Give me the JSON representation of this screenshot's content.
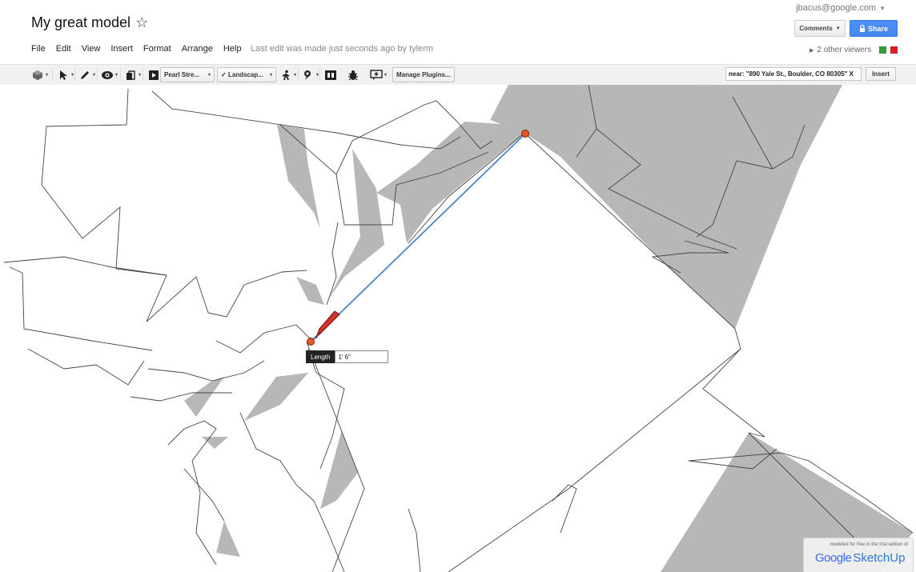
{
  "header": {
    "title": "My great model",
    "star_glyph": "☆",
    "account": "jbacus@google.com",
    "comments_label": "Comments",
    "share_label": "Share",
    "last_edit": "Last edit was made just seconds ago by tylerm",
    "viewers_label": "2 other viewers",
    "viewer_colors": [
      "#3a9a3a",
      "#d42020"
    ]
  },
  "menu": [
    "File",
    "Edit",
    "View",
    "Insert",
    "Format",
    "Arrange",
    "Help"
  ],
  "toolbar": {
    "tools": [
      "cube-icon",
      "select-arrow-icon",
      "pencil-icon",
      "eye-icon",
      "layers-icon"
    ],
    "scene_dropdown": "Pearl Stre...",
    "style_dropdown": "✓ Landscap...",
    "extra_tools": [
      "walk-icon",
      "location-pin-icon",
      "component-icon",
      "bug-icon",
      "comment-icon"
    ],
    "manage_plugins": "Manage Plugins...",
    "search_value": "near: \"890 Yale St., Boulder, CO 80305\" X",
    "insert_label": "Insert"
  },
  "canvas": {
    "length_label": "Length",
    "length_value": "1' 6\"",
    "branding_small": "modeled for free in the trial edition of",
    "branding_google": "Google",
    "branding_product": "SketchUp",
    "colors": {
      "shadow": "#b7b7b7",
      "edge": "#3a3a3a",
      "draw_line": "#4a86c8",
      "endpoint": "#e25a2b"
    }
  }
}
